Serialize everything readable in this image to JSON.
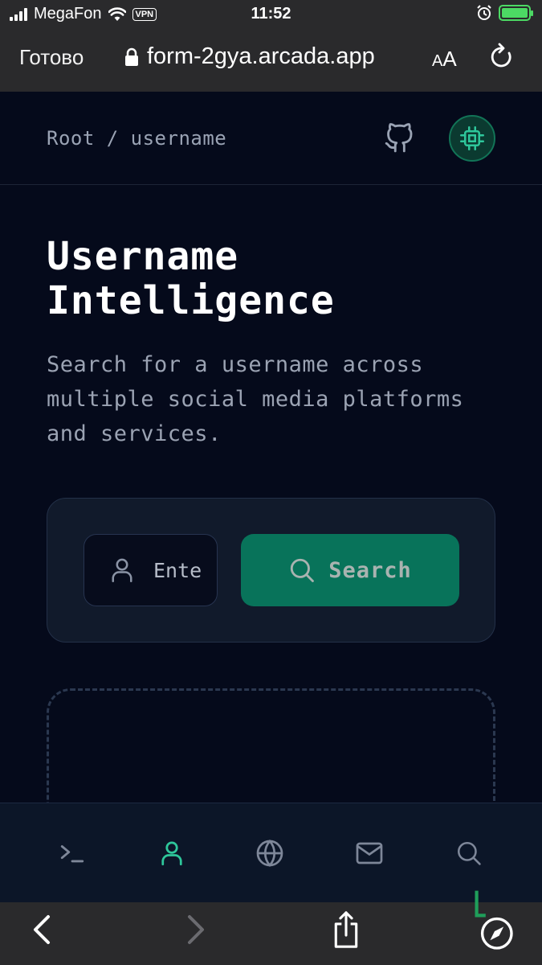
{
  "status_bar": {
    "carrier": "MegaFon",
    "vpn": "VPN",
    "time": "11:52"
  },
  "browser": {
    "done_label": "Готово",
    "url": "form-2gya.arcada.app",
    "text_size_label_small": "A",
    "text_size_label_large": "A"
  },
  "header": {
    "breadcrumb": "Root / username"
  },
  "hero": {
    "title_line1": "Username",
    "title_line2": "Intelligence",
    "subtitle": "Search for a username across multiple social media platforms and services."
  },
  "search": {
    "placeholder": "Enter username",
    "button_label": "Search"
  },
  "bottom_nav": {
    "items": [
      "terminal",
      "user",
      "globe",
      "mail",
      "search"
    ],
    "active": "user"
  },
  "colors": {
    "accent": "#08735a",
    "accent_active_icon": "#2ec79b",
    "background": "#050a1b",
    "card": "#111a2b"
  }
}
